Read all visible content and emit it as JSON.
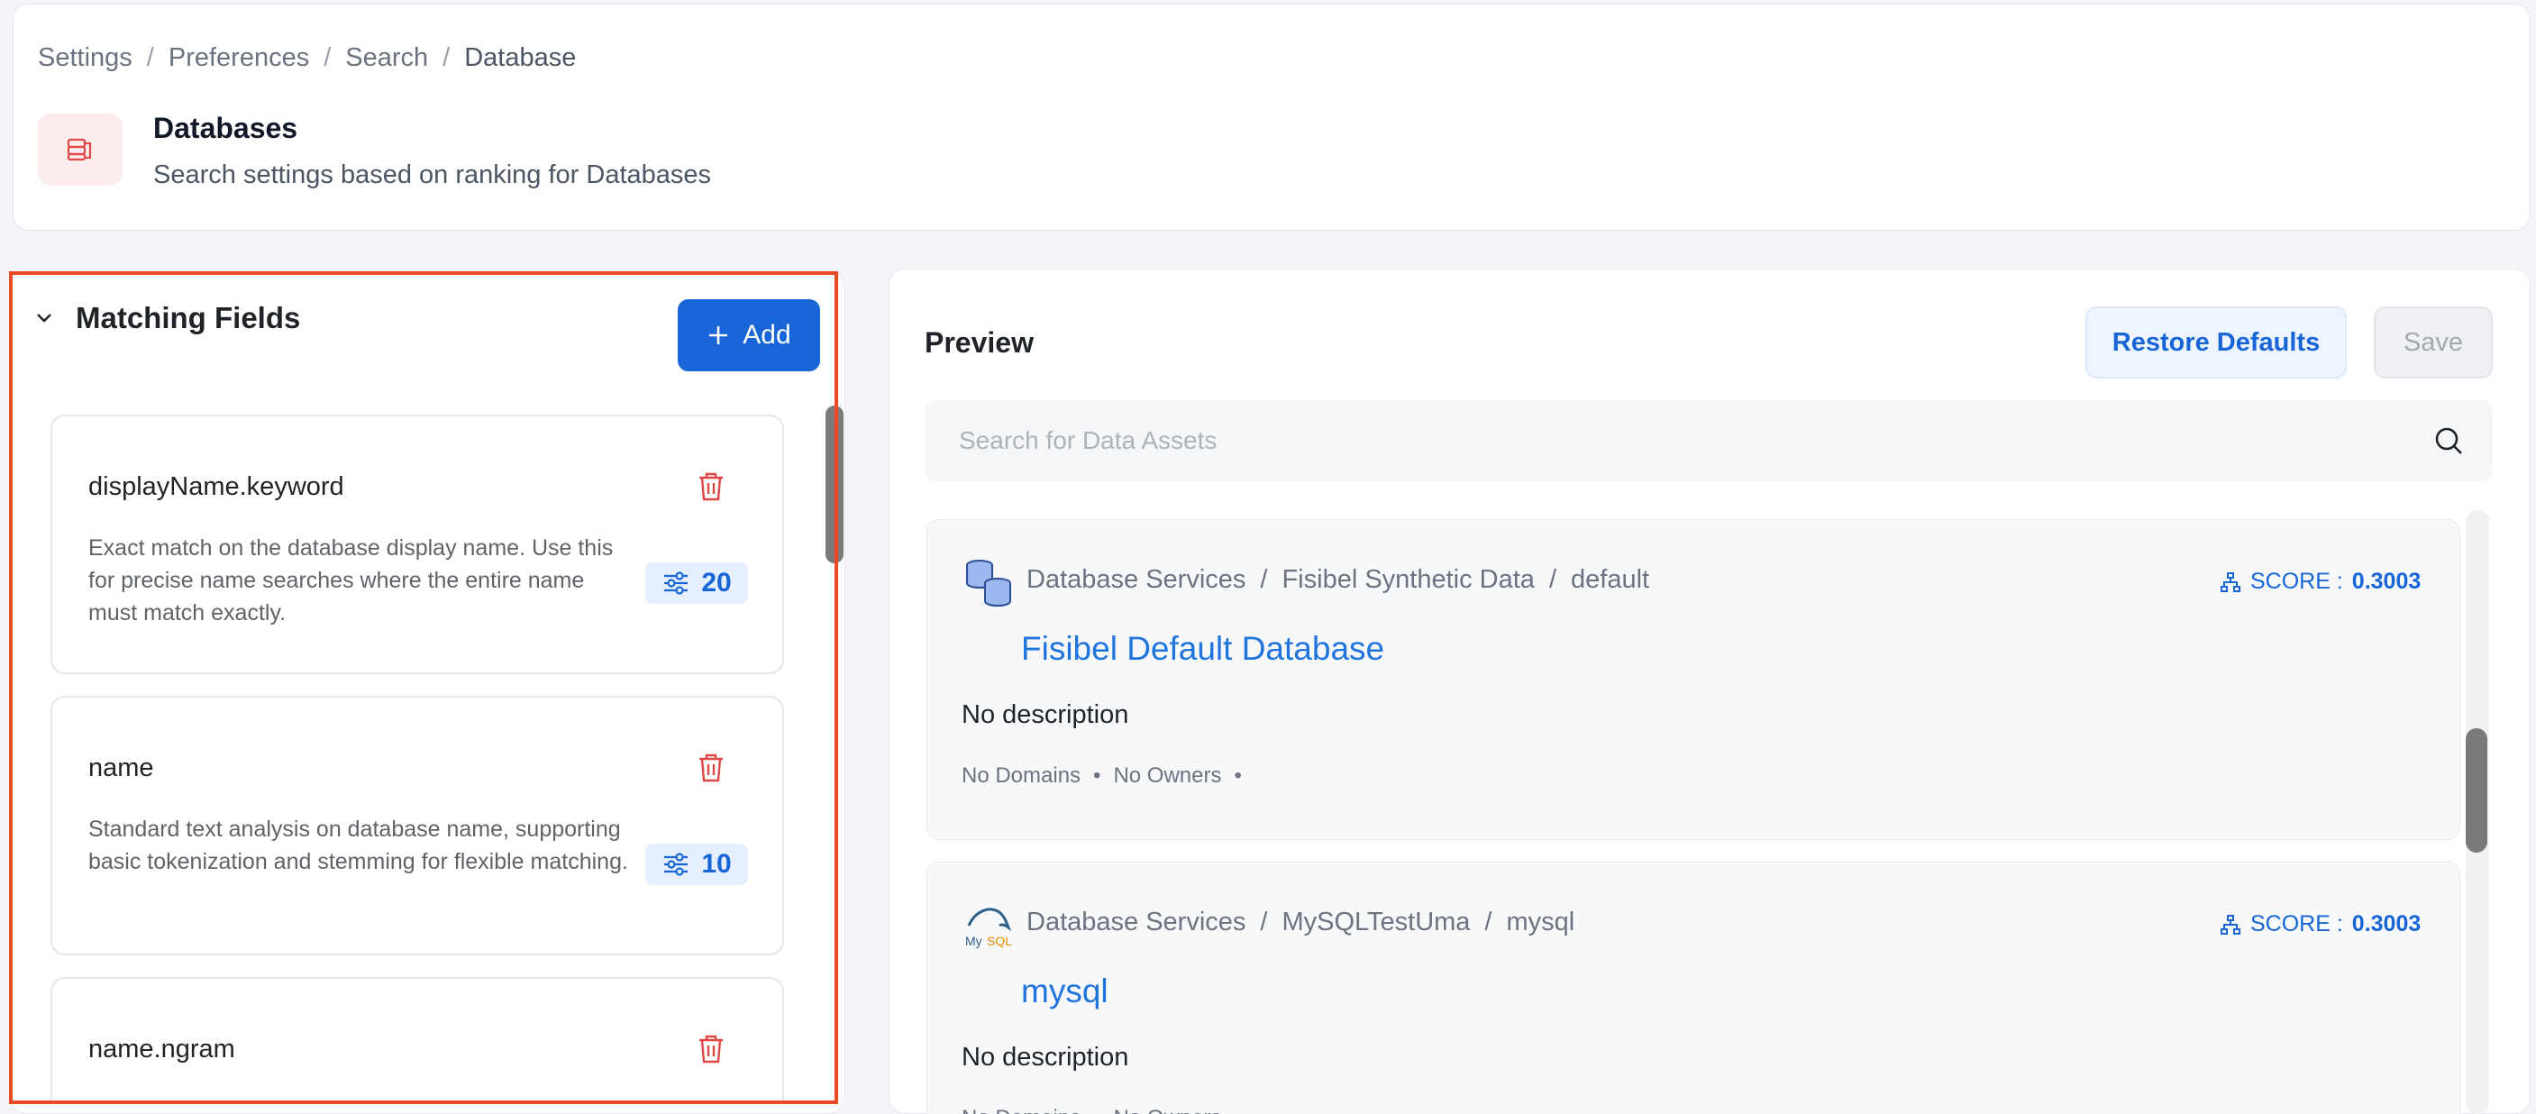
{
  "breadcrumb": [
    "Settings",
    "Preferences",
    "Search",
    "Database"
  ],
  "header": {
    "title": "Databases",
    "subtitle": "Search settings based on ranking for Databases"
  },
  "matching_fields": {
    "title": "Matching Fields",
    "add_label": "Add",
    "fields": [
      {
        "name": "displayName.keyword",
        "description": "Exact match on the database display name. Use this for precise name searches where the entire name must match exactly.",
        "weight": "20"
      },
      {
        "name": "name",
        "description": "Standard text analysis on database name, supporting basic tokenization and stemming for flexible matching.",
        "weight": "10"
      },
      {
        "name": "name.ngram",
        "description": "",
        "weight": ""
      }
    ]
  },
  "preview": {
    "title": "Preview",
    "restore_label": "Restore Defaults",
    "save_label": "Save",
    "search_placeholder": "Search for Data Assets",
    "results": [
      {
        "path": [
          "Database Services",
          "Fisibel Synthetic Data",
          "default"
        ],
        "score_label": "SCORE :",
        "score": "0.3003",
        "name": "Fisibel Default Database",
        "description": "No description",
        "domains": "No Domains",
        "owners": "No Owners"
      },
      {
        "path": [
          "Database Services",
          "MySQLTestUma",
          "mysql"
        ],
        "score_label": "SCORE :",
        "score": "0.3003",
        "name": "mysql",
        "description": "No description",
        "domains": "No Domains",
        "owners": "No Owners"
      }
    ]
  },
  "colors": {
    "accent": "#1765d6",
    "highlight": "#ea4a22",
    "danger": "#e04848"
  }
}
